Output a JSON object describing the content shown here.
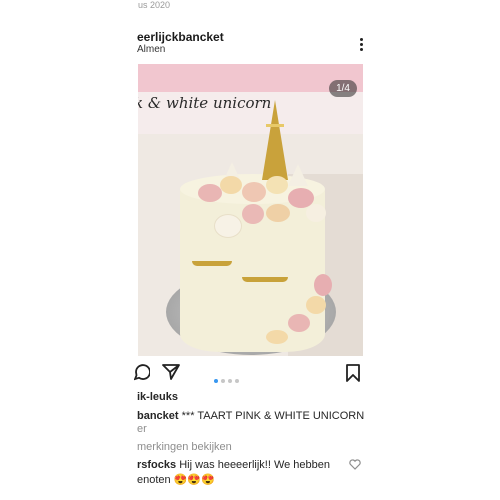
{
  "header": {
    "top_date": "us 2020",
    "username": "eerlijckbancket",
    "location": "Almen"
  },
  "post": {
    "image_text": "k & white unicorn",
    "counter": "1/4",
    "likes_line": "ik-leuks",
    "caption_user": "bancket",
    "caption_text": " *** TAART PINK & WHITE UNICORN",
    "caption_more": "er",
    "view_comments": "merkingen bekijken",
    "comment_user": "rsfocks",
    "comment_text": " Hij was heeeerlijk!! We hebben",
    "comment_line2": "enoten 😍😍😍"
  },
  "icons": {
    "more": "more-vertical-icon",
    "comment": "comment-icon",
    "share": "send-icon",
    "save": "bookmark-icon",
    "like_comment": "heart-icon"
  },
  "colors": {
    "accent_dot": "#3897f0"
  }
}
